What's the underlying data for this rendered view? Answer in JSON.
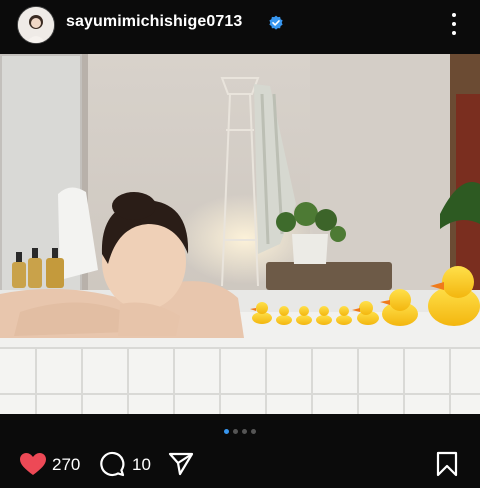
{
  "post": {
    "username": "sayumimichishige0713",
    "verified": true,
    "likes": "270",
    "comments": "10",
    "carousel": {
      "total": 4,
      "active": 1
    }
  },
  "icons": {
    "verified": "verified-badge-icon",
    "more": "more-options-icon",
    "like": "heart-icon",
    "comment": "comment-bubble-icon",
    "share": "paper-plane-icon",
    "save": "bookmark-icon"
  },
  "colors": {
    "background": "#0b0b0b",
    "like": "#ed4956",
    "verified": "#3897f0",
    "carousel_active": "#3897f0"
  }
}
